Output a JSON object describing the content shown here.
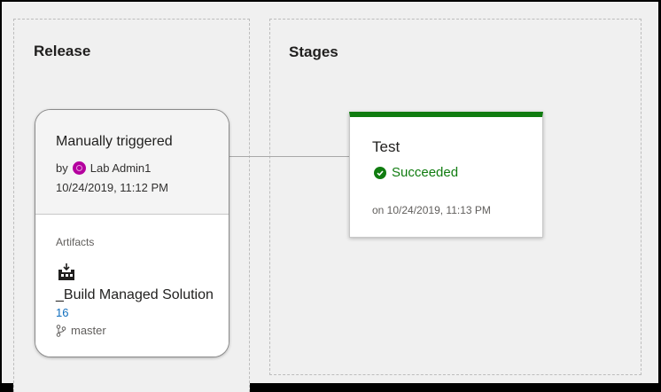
{
  "release": {
    "section_title": "Release",
    "trigger": "Manually triggered",
    "by_label": "by",
    "user": "Lab Admin1",
    "date": "10/24/2019, 11:12 PM",
    "artifacts_label": "Artifacts",
    "artifact": {
      "name": "_Build Managed Solution",
      "build_number": "16",
      "branch": "master"
    }
  },
  "stages": {
    "section_title": "Stages",
    "items": [
      {
        "name": "Test",
        "status": "Succeeded",
        "status_color": "#107c10",
        "completed": "on 10/24/2019, 11:13 PM"
      }
    ]
  },
  "icons": {
    "user_avatar": "user-avatar-icon",
    "build": "build-artifact-icon",
    "branch": "git-branch-icon",
    "status": "check-circle-icon"
  }
}
